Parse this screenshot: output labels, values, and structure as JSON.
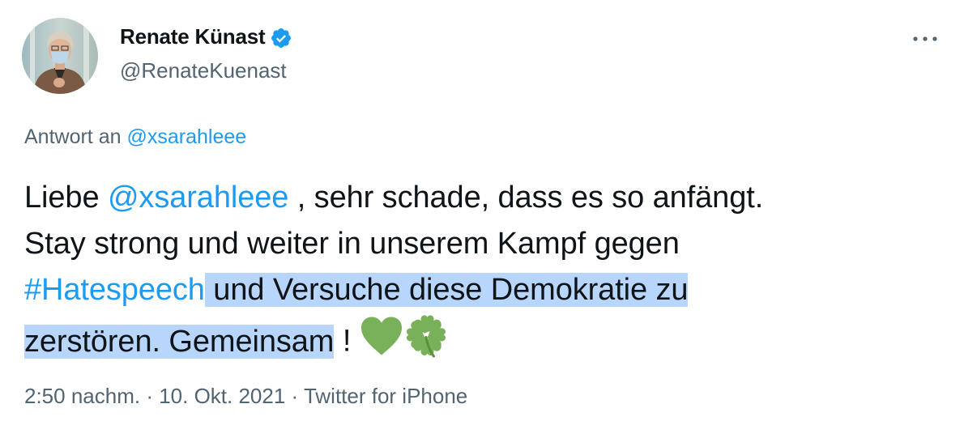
{
  "author": {
    "display_name": "Renate Künast",
    "handle": "@RenateKuenast",
    "verified_icon": "verified-badge-icon",
    "avatar": "profile-photo"
  },
  "menu": {
    "icon": "more-horizontal-icon"
  },
  "reply": {
    "prefix": "Antwort an",
    "target": "@xsarahleee"
  },
  "tweet": {
    "seg_1": "Liebe ",
    "mention": "@xsarahleee",
    "seg_2": " , sehr schade, dass es so anfängt.",
    "seg_3": "Stay strong und weiter in unserem Kampf gegen",
    "hashtag": "#Hatespeech",
    "seg_4": " und Versuche diese Demokratie zu",
    "seg_5": "zerstören. Gemeinsam",
    "seg_6": " ! ",
    "emoji_1": "green-heart-icon",
    "emoji_2": "four-leaf-clover-icon"
  },
  "meta": {
    "time": "2:50 nachm.",
    "date": "10. Okt. 2021",
    "source": "Twitter for iPhone",
    "separator": " · "
  },
  "colors": {
    "link": "#1d9bf0",
    "secondary_text": "#536471",
    "primary_text": "#0f1419",
    "selection": "#b8d6fb",
    "emoji_green": "#78b159"
  }
}
